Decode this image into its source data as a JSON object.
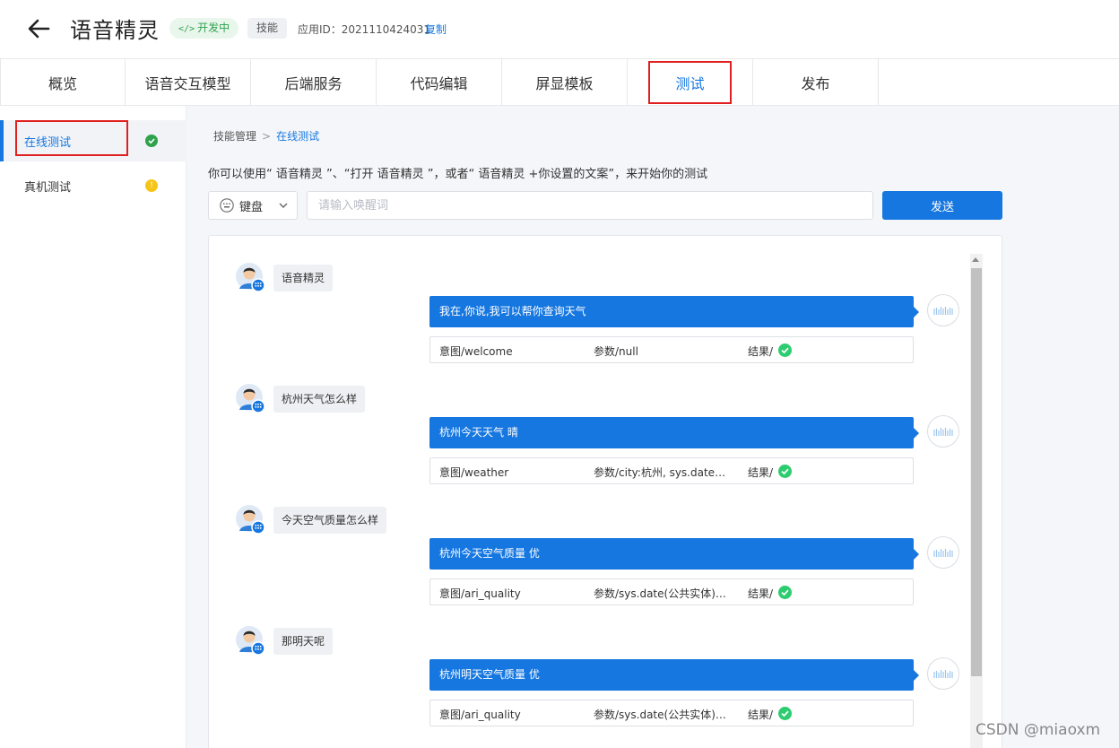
{
  "header": {
    "title": "语音精灵",
    "status_code_glyph": "</>",
    "status": "开发中",
    "type": "技能",
    "app_id": "应用ID：2021110424031",
    "copy": "复制"
  },
  "tabs": [
    {
      "label": "概览"
    },
    {
      "label": "语音交互模型"
    },
    {
      "label": "后端服务"
    },
    {
      "label": "代码编辑"
    },
    {
      "label": "屏显模板"
    },
    {
      "label": "测试",
      "active": true
    },
    {
      "label": "发布"
    }
  ],
  "sidebar": {
    "items": [
      {
        "label": "在线测试",
        "status_icon": "check-icon",
        "status_color": "#2ea24d",
        "active": true
      },
      {
        "label": "真机测试",
        "status_icon": "warning-icon",
        "status_color": "#f5c518"
      }
    ]
  },
  "breadcrumb": {
    "root": "技能管理",
    "separator": ">",
    "current": "在线测试"
  },
  "intro": "你可以使用“ 语音精灵 ”、“打开 语音精灵 ”，或者“ 语音精灵 +你设置的文案”，来开始你的测试",
  "input": {
    "mode": "键盘",
    "placeholder": "请输入唤醒词",
    "send": "发送"
  },
  "conversation": [
    {
      "user": "语音精灵",
      "bot": "我在,你说,我可以帮你查询天气",
      "intent": "意图/welcome",
      "params": "参数/null",
      "result": "结果/"
    },
    {
      "user": "杭州天气怎么样",
      "bot": "杭州今天天气 晴",
      "intent": "意图/weather",
      "params": "参数/city:杭州, sys.date(公...",
      "result": "结果/"
    },
    {
      "user": "今天空气质量怎么样",
      "bot": "杭州今天空气质量 优",
      "intent": "意图/ari_quality",
      "params": "参数/sys.date(公共实体):...",
      "result": "结果/"
    },
    {
      "user": "那明天呢",
      "bot": "杭州明天空气质量 优",
      "intent": "意图/ari_quality",
      "params": "参数/sys.date(公共实体):...",
      "result": "结果/"
    }
  ],
  "colors": {
    "accent": "#1677e0",
    "success": "#2ecc71",
    "highlight_box": "#e02020"
  },
  "watermark": "CSDN @miaoxm"
}
